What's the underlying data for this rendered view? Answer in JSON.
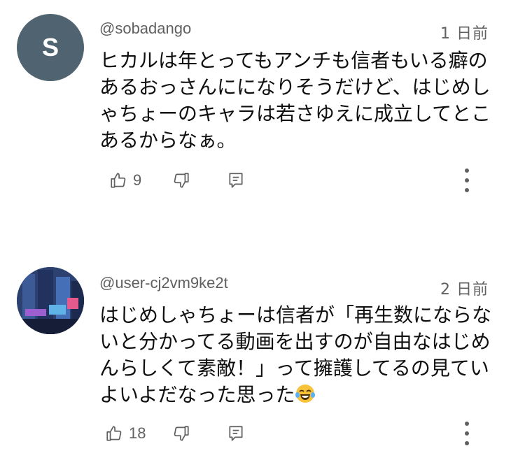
{
  "comments": [
    {
      "avatar_letter": "S",
      "author": "@sobadango",
      "date": "1 日前",
      "text": "ヒカルは年とってもアンチも信者もいる癖のあるおっさんにになりそうだけど、はじめしゃちょーのキャラは若さゆえに成立してとこあるからなぁ。",
      "likes": "9",
      "icons": [
        "thumb-up-icon",
        "thumb-down-icon",
        "reply-icon",
        "more-vert-icon"
      ]
    },
    {
      "author": "@user-cj2vm9ke2t",
      "date": "2 日前",
      "text": "はじめしゃちょーは信者が「再生数にならないと分かってる動画を出すのが自由なはじめんらしくて素敵！」って擁護してるの見ていよいよだなった思った",
      "emoji": "😂",
      "likes": "18",
      "icons": [
        "thumb-up-icon",
        "thumb-down-icon",
        "reply-icon",
        "more-vert-icon"
      ]
    }
  ],
  "colors": {
    "text": "#0f0f0f",
    "secondary": "#606060",
    "avatar_bg": "#4f6370",
    "icon": "#606060"
  }
}
